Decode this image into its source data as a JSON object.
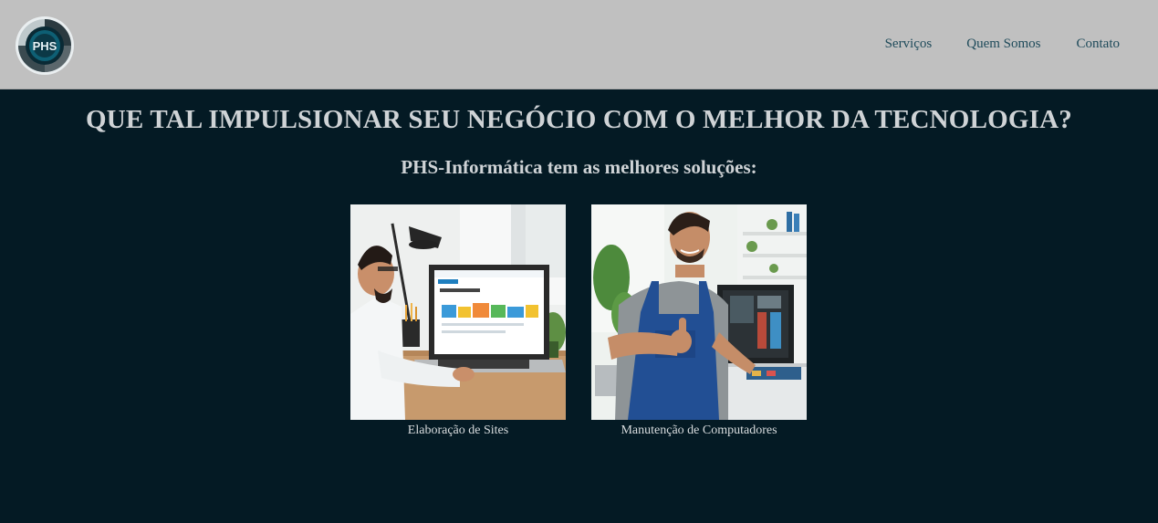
{
  "header": {
    "logo_text": "PHS",
    "nav": {
      "servicos": "Serviços",
      "quem_somos": "Quem Somos",
      "contato": "Contato"
    }
  },
  "main": {
    "headline": "QUE TAL IMPULSIONAR SEU NEGÓCIO COM O MELHOR DA TECNOLOGIA?",
    "subheadline": "PHS-Informática tem as melhores soluções:",
    "services": [
      {
        "caption": "Elaboração de Sites"
      },
      {
        "caption": "Manutenção de Computadores"
      }
    ]
  },
  "colors": {
    "header_bg": "#c0c0c0",
    "page_bg": "#041a24",
    "nav_text": "#1e4a5a",
    "heading_text": "#cfd3d6"
  }
}
